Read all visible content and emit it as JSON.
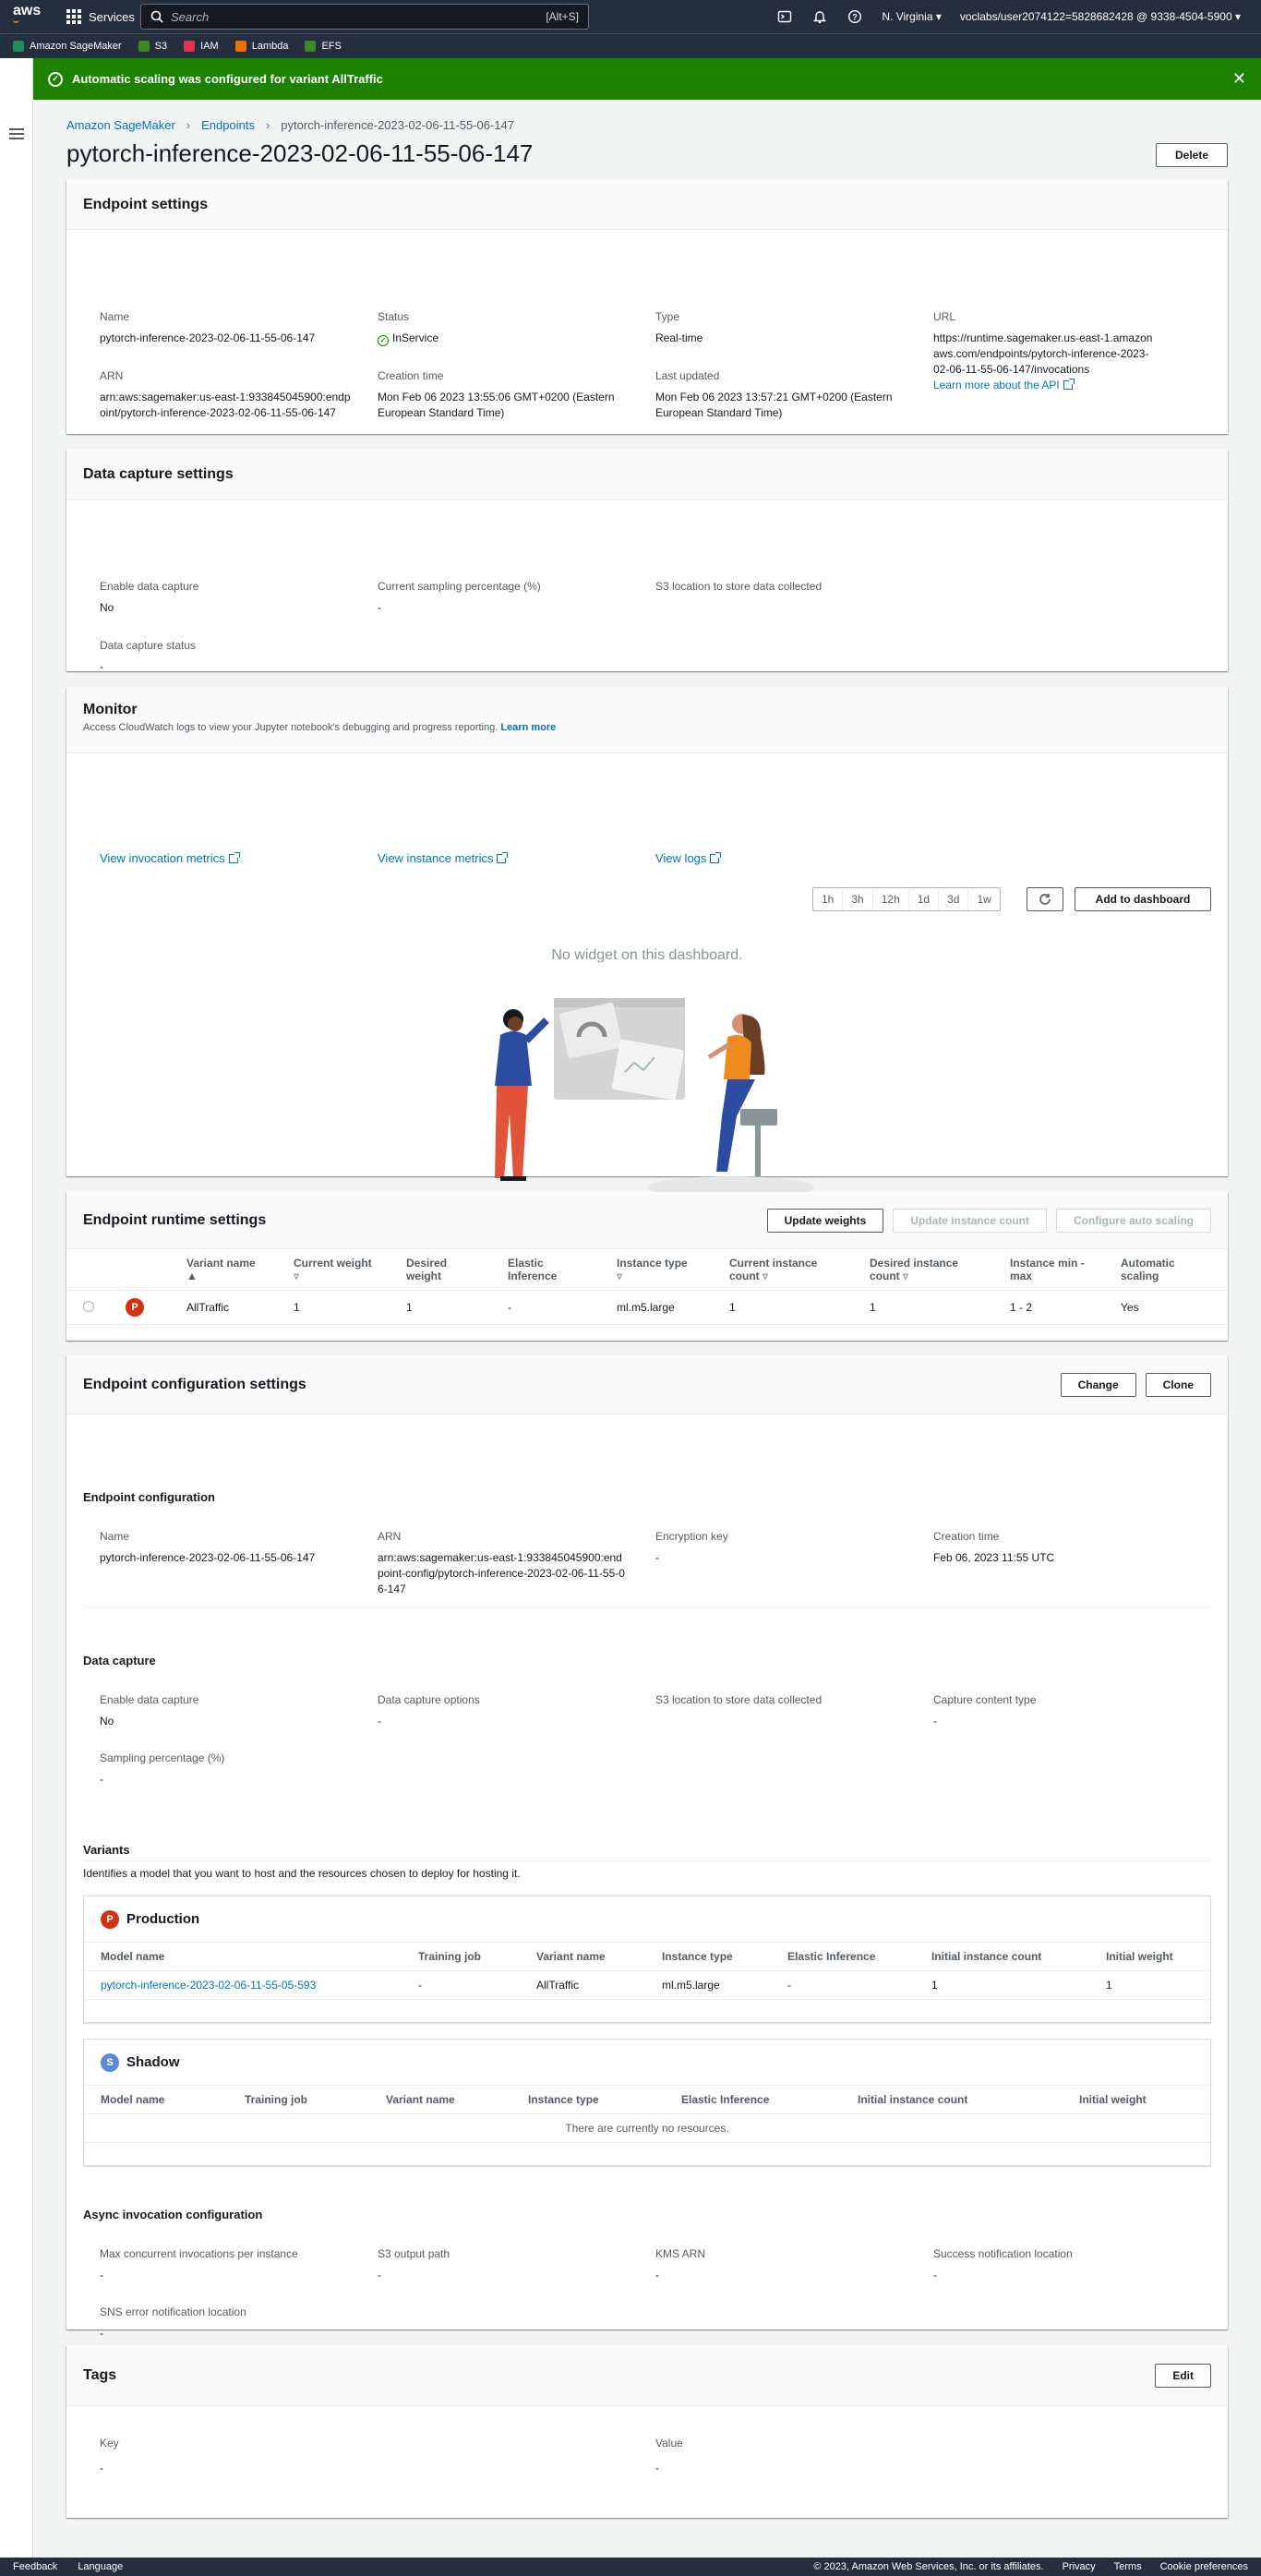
{
  "nav": {
    "logo": "aws",
    "services_label": "Services",
    "search_placeholder": "Search",
    "search_shortcut": "[Alt+S]",
    "region": "N. Virginia ▾",
    "account": "voclabs/user2074122=5828682428 @ 9338-4504-5900 ▾"
  },
  "favorites": [
    {
      "label": "Amazon SageMaker",
      "color": "#1d8f5f"
    },
    {
      "label": "S3",
      "color": "#3f8624"
    },
    {
      "label": "IAM",
      "color": "#dd344c"
    },
    {
      "label": "Lambda",
      "color": "#ed7100"
    },
    {
      "label": "EFS",
      "color": "#3f8624"
    }
  ],
  "flash": {
    "message": "Automatic scaling was configured for variant AllTraffic"
  },
  "breadcrumb": {
    "items": [
      "Amazon SageMaker",
      "Endpoints"
    ],
    "current": "pytorch-inference-2023-02-06-11-55-06-147"
  },
  "page": {
    "title": "pytorch-inference-2023-02-06-11-55-06-147",
    "delete_label": "Delete"
  },
  "endpoint_settings": {
    "title": "Endpoint settings",
    "name_label": "Name",
    "name": "pytorch-inference-2023-02-06-11-55-06-147",
    "status_label": "Status",
    "status": "InService",
    "type_label": "Type",
    "type": "Real-time",
    "url_label": "URL",
    "url": "https://runtime.sagemaker.us-east-1.amazonaws.com/endpoints/pytorch-inference-2023-02-06-11-55-06-147/invocations",
    "learn_api": "Learn more about the API",
    "arn_label": "ARN",
    "arn": "arn:aws:sagemaker:us-east-1:933845045900:endpoint/pytorch-inference-2023-02-06-11-55-06-147",
    "creation_label": "Creation time",
    "creation": "Mon Feb 06 2023 13:55:06 GMT+0200 (Eastern European Standard Time)",
    "updated_label": "Last updated",
    "updated": "Mon Feb 06 2023 13:57:21 GMT+0200 (Eastern European Standard Time)"
  },
  "data_capture": {
    "title": "Data capture settings",
    "enable_label": "Enable data capture",
    "enable": "No",
    "sampling_label": "Current sampling percentage (%)",
    "sampling": "-",
    "s3_label": "S3 location to store data collected",
    "status_label": "Data capture status",
    "status": "-"
  },
  "monitor": {
    "title": "Monitor",
    "subtitle": "Access CloudWatch logs to view your Jupyter notebook's debugging and progress reporting.",
    "learn_more": "Learn more",
    "link1": "View invocation metrics",
    "link2": "View instance metrics",
    "link3": "View logs",
    "ranges": [
      "1h",
      "3h",
      "12h",
      "1d",
      "3d",
      "1w"
    ],
    "add_dashboard": "Add to dashboard",
    "empty": "No widget on this dashboard."
  },
  "runtime": {
    "title": "Endpoint runtime settings",
    "update_weights": "Update weights",
    "update_count": "Update instance count",
    "configure_scaling": "Configure auto scaling",
    "headers": [
      "Variant name",
      "Current weight",
      "Desired weight",
      "Elastic Inference",
      "Instance type",
      "Current instance count",
      "Desired instance count",
      "Instance min - max",
      "Automatic scaling"
    ],
    "row": {
      "badge": "P",
      "variant": "AllTraffic",
      "current_weight": "1",
      "desired_weight": "1",
      "elastic": "-",
      "instance_type": "ml.m5.large",
      "current_count": "1",
      "desired_count": "1",
      "minmax": "1 - 2",
      "scaling": "Yes"
    }
  },
  "config": {
    "title": "Endpoint configuration settings",
    "change": "Change",
    "clone": "Clone",
    "ec_heading": "Endpoint configuration",
    "name_label": "Name",
    "name": "pytorch-inference-2023-02-06-11-55-06-147",
    "arn_label": "ARN",
    "arn": "arn:aws:sagemaker:us-east-1:933845045900:endpoint-config/pytorch-inference-2023-02-06-11-55-06-147",
    "enc_label": "Encryption key",
    "enc": "-",
    "ctime_label": "Creation time",
    "ctime": "Feb 06, 2023 11:55 UTC",
    "dc_heading": "Data capture",
    "dc_enable_label": "Enable data capture",
    "dc_enable": "No",
    "dc_options_label": "Data capture options",
    "dc_options": "-",
    "dc_s3_label": "S3 location to store data collected",
    "dc_ctype_label": "Capture content type",
    "dc_ctype": "-",
    "dc_sampling_label": "Sampling percentage (%)",
    "dc_sampling": "-",
    "variants_heading": "Variants",
    "variants_desc": "Identifies a model that you want to host and the resources chosen to deploy for hosting it.",
    "production": "Production",
    "shadow": "Shadow",
    "variant_headers": [
      "Model name",
      "Training job",
      "Variant name",
      "Instance type",
      "Elastic Inference",
      "Initial instance count",
      "Initial weight"
    ],
    "prod_row": {
      "model": "pytorch-inference-2023-02-06-11-55-05-593",
      "job": "-",
      "variant": "AllTraffic",
      "itype": "ml.m5.large",
      "elastic": "-",
      "count": "1",
      "weight": "1"
    },
    "no_resources": "There are currently no resources.",
    "async_heading": "Async invocation configuration",
    "max_conc_label": "Max concurrent invocations per instance",
    "max_conc": "-",
    "s3_out_label": "S3 output path",
    "s3_out": "-",
    "kms_label": "KMS ARN",
    "kms": "-",
    "success_label": "Success notification location",
    "success": "-",
    "sns_label": "SNS error notification location",
    "sns": "-"
  },
  "tags": {
    "title": "Tags",
    "edit": "Edit",
    "key_label": "Key",
    "key": "-",
    "value_label": "Value",
    "value": "-"
  },
  "footer": {
    "feedback": "Feedback",
    "language": "Language",
    "copyright": "© 2023, Amazon Web Services, Inc. or its affiliates.",
    "privacy": "Privacy",
    "terms": "Terms",
    "cookie": "Cookie preferences"
  }
}
